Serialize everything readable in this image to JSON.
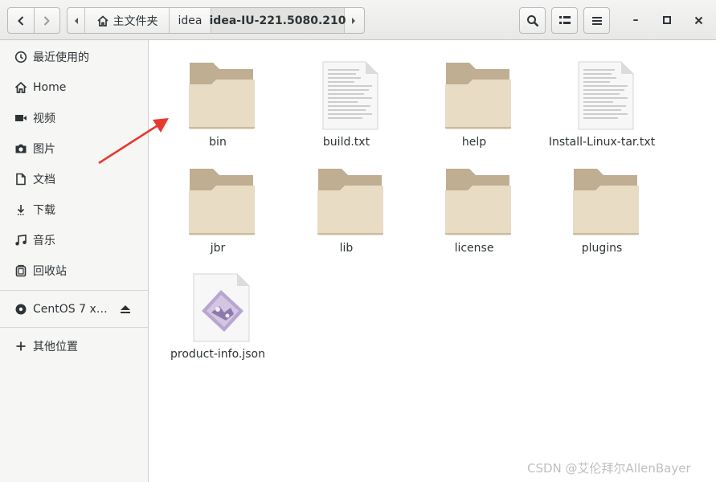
{
  "header": {
    "back_icon": "chevron-left-icon",
    "forward_icon": "chevron-right-icon",
    "path_left_arrow": "path-scroll-left-icon",
    "path_right_arrow": "path-scroll-right-icon",
    "home_icon": "home-icon",
    "breadcrumbs": [
      "主文件夹",
      "idea",
      "idea-IU-221.5080.210"
    ],
    "search_icon": "search-icon",
    "view_toggle_icon": "grid-view-icon",
    "menu_icon": "hamburger-menu-icon",
    "minimize": "–",
    "maximize": "□",
    "close": "×"
  },
  "sidebar": {
    "items": [
      {
        "label": "最近使用的",
        "icon": "recent-clock-icon"
      },
      {
        "label": "Home",
        "icon": "home-icon"
      },
      {
        "label": "视频",
        "icon": "video-icon"
      },
      {
        "label": "图片",
        "icon": "camera-icon"
      },
      {
        "label": "文档",
        "icon": "document-icon"
      },
      {
        "label": "下载",
        "icon": "download-icon"
      },
      {
        "label": "音乐",
        "icon": "music-icon"
      },
      {
        "label": "回收站",
        "icon": "trash-icon"
      }
    ],
    "devices": [
      {
        "label": "CentOS 7 x…",
        "icon": "disc-icon",
        "eject_icon": "eject-icon"
      }
    ],
    "other": {
      "label": "其他位置",
      "icon": "plus-icon"
    }
  },
  "files": [
    {
      "name": "bin",
      "type": "folder"
    },
    {
      "name": "build.txt",
      "type": "text"
    },
    {
      "name": "help",
      "type": "folder"
    },
    {
      "name": "Install-Linux-tar.txt",
      "type": "text"
    },
    {
      "name": "jbr",
      "type": "folder"
    },
    {
      "name": "lib",
      "type": "folder"
    },
    {
      "name": "license",
      "type": "folder"
    },
    {
      "name": "plugins",
      "type": "folder"
    },
    {
      "name": "product-info.json",
      "type": "json"
    }
  ],
  "watermark": "CSDN @艾伦拜尔AllenBayer",
  "colors": {
    "folder_back": "#bfae91",
    "folder_front": "#e9dcc4",
    "annotation_arrow": "#e8392f"
  }
}
